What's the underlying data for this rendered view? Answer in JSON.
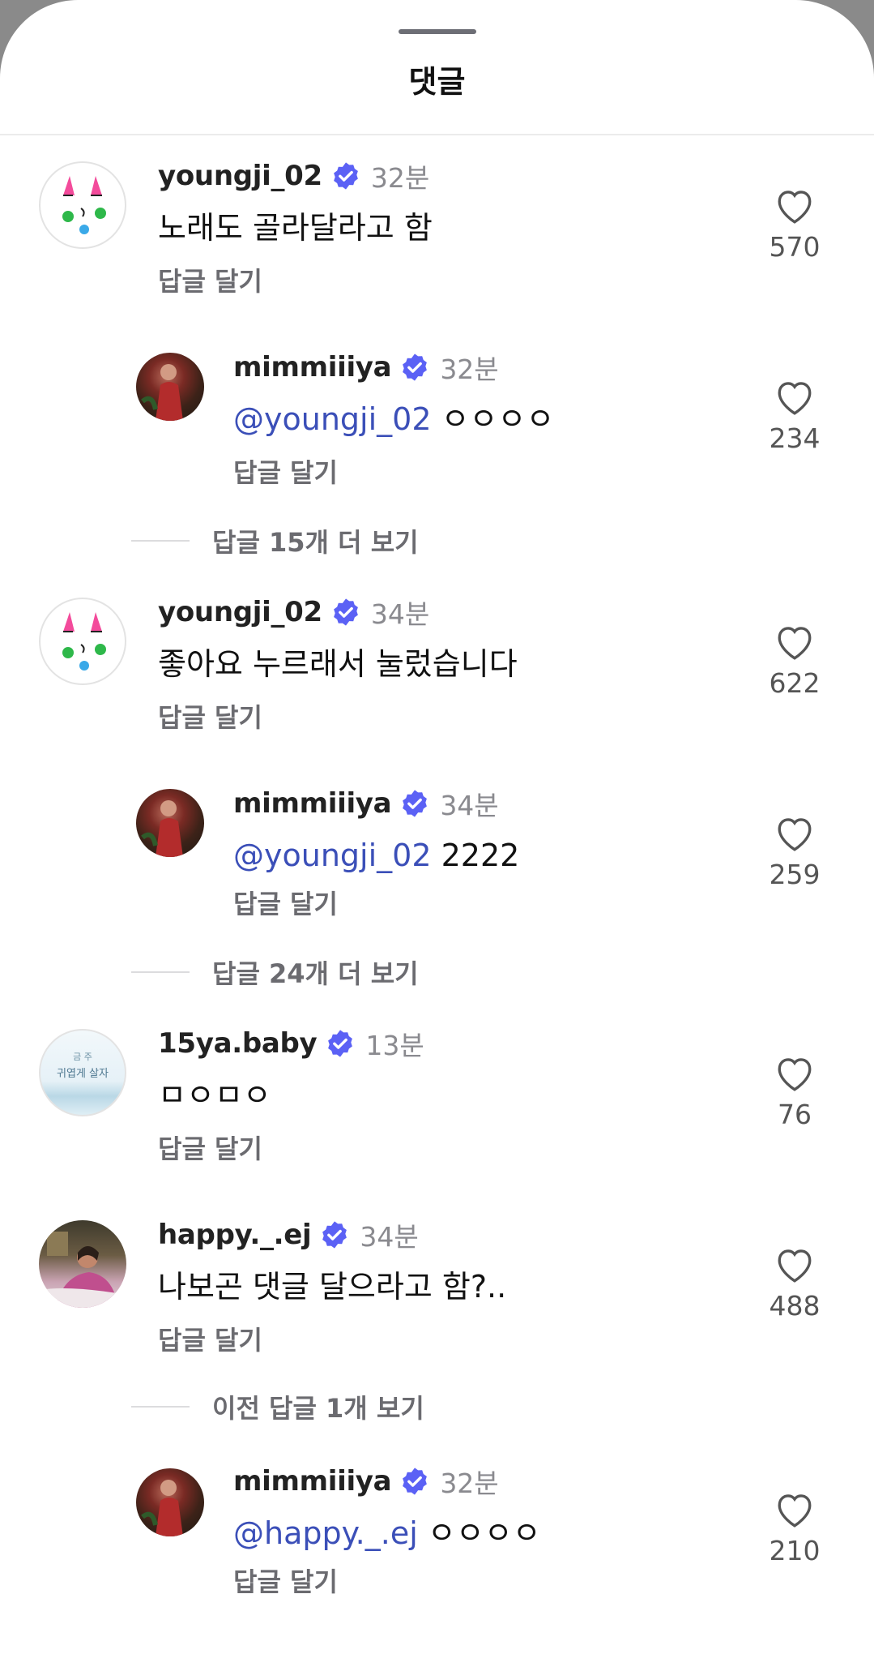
{
  "header": {
    "title": "댓글"
  },
  "colors": {
    "accent": "#5b61f5",
    "mention": "#3b4fb8",
    "muted": "#6b6b70"
  },
  "comments": [
    {
      "username": "youngji_02",
      "time": "32분",
      "text": "노래도 골라달라고 함",
      "reply_label": "답글 달기",
      "likes": "570"
    },
    {
      "username": "mimmiiiya",
      "time": "32분",
      "mention": "@youngji_02",
      "text": "ㅇㅇㅇㅇ",
      "reply_label": "답글 달기",
      "likes": "234"
    },
    {
      "username": "youngji_02",
      "time": "34분",
      "text": "좋아요 누르래서 눌렀습니다",
      "reply_label": "답글 달기",
      "likes": "622"
    },
    {
      "username": "mimmiiiya",
      "time": "34분",
      "mention": "@youngji_02",
      "text": "2222",
      "reply_label": "답글 달기",
      "likes": "259"
    },
    {
      "username": "15ya.baby",
      "time": "13분",
      "text": "ㅁㅇㅁㅇ",
      "reply_label": "답글 달기",
      "likes": "76",
      "avatar_text": [
        "금 주",
        "귀엽게 살자"
      ]
    },
    {
      "username": "happy._.ej",
      "time": "34분",
      "text": "나보곤 댓글 달으라고 함?..",
      "reply_label": "답글 달기",
      "likes": "488"
    },
    {
      "username": "mimmiiiya",
      "time": "32분",
      "mention": "@happy._.ej",
      "text": "ㅇㅇㅇㅇ",
      "reply_label": "답글 달기",
      "likes": "210"
    }
  ],
  "view_more": [
    {
      "label": "답글 15개 더 보기"
    },
    {
      "label": "답글 24개 더 보기"
    },
    {
      "label": "이전 답글 1개 보기"
    }
  ]
}
